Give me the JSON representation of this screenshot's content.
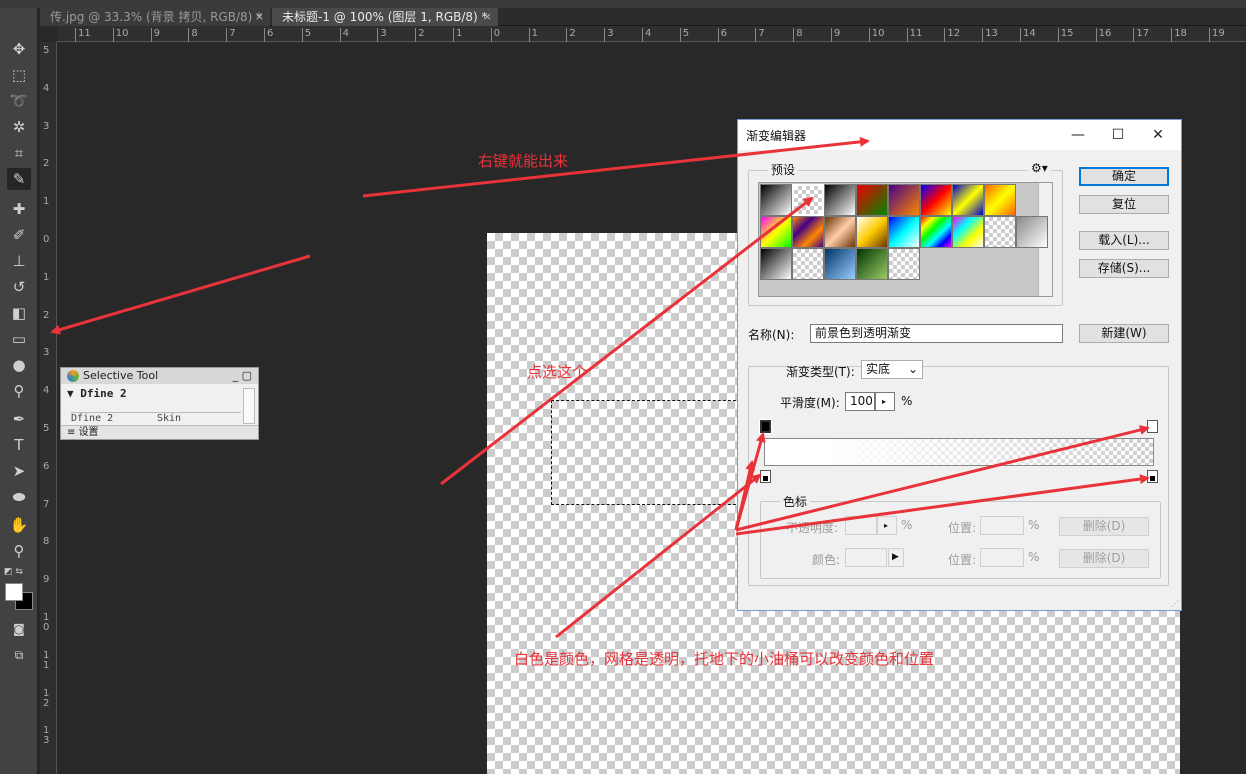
{
  "tabs": [
    {
      "label": "传.jpg @ 33.3% (背景 拷贝, RGB/8) *",
      "close": "×"
    },
    {
      "label": "未标题-1 @ 100% (图层 1, RGB/8) *",
      "close": "×"
    }
  ],
  "ruler": {
    "h": [
      "11",
      "10",
      "9",
      "8",
      "7",
      "6",
      "5",
      "4",
      "3",
      "2",
      "1",
      "0",
      "1",
      "2",
      "3",
      "4",
      "5",
      "6",
      "7",
      "8",
      "9",
      "10",
      "11",
      "12",
      "13",
      "14",
      "15",
      "16",
      "17",
      "18",
      "19"
    ],
    "v": [
      "5",
      "4",
      "3",
      "2",
      "1",
      "0",
      "1",
      "2",
      "3",
      "4",
      "5",
      "6",
      "7",
      "8",
      "9",
      "1\n0",
      "1\n1",
      "1\n2",
      "1\n3"
    ]
  },
  "tools": [
    "move-icon",
    "marquee-icon",
    "lasso-icon",
    "magic-wand-icon",
    "crop-icon",
    "eyedropper-icon",
    "healing-icon",
    "brush-icon",
    "stamp-icon",
    "history-brush-icon",
    "eraser-icon",
    "gradient-icon",
    "blur-icon",
    "dodge-icon",
    "pen-icon",
    "text-icon",
    "path-select-icon",
    "shape-icon",
    "hand-icon",
    "zoom-icon"
  ],
  "selective_tool": {
    "title": "Selective Tool",
    "plugin": "Dfine 2",
    "sub_left": "Dfine 2",
    "sub_right": "Skin",
    "footer": "设置"
  },
  "dialog": {
    "title": "渐变编辑器",
    "presets_label": "预设",
    "ok": "确定",
    "reset": "复位",
    "load": "载入(L)...",
    "save": "存储(S)...",
    "name_label": "名称(N):",
    "name_value": "前景色到透明渐变",
    "new": "新建(W)",
    "gradient_type_label": "渐变类型(T):",
    "gradient_type_value": "实底",
    "smoothness_label": "平滑度(M):",
    "smoothness_value": "100",
    "percent": "%",
    "stops_label": "色标",
    "opacity_label": "不透明度:",
    "location_label": "位置:",
    "delete": "删除(D)",
    "color_label": "颜色:"
  },
  "annotations": {
    "right_click": "右键就能出来",
    "select_this": "点选这个",
    "explain": "白色是颜色，网格是透明，托地下的小油桶可以改变颜色和位置"
  },
  "colors": {
    "annotation": "#e8333a",
    "workspace": "#282828",
    "dialog_accent": "#0078d7"
  }
}
